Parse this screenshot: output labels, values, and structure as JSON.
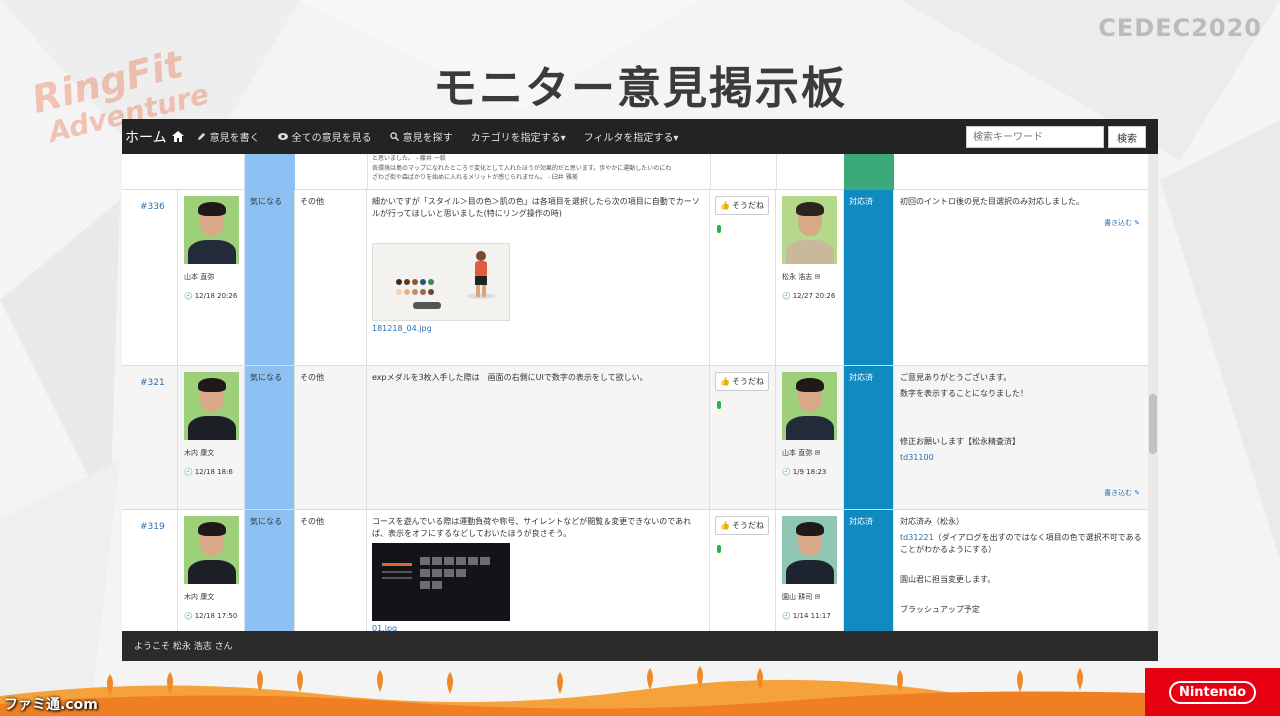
{
  "slide": {
    "title": "モニター意見掲示板",
    "cedec": "CEDEC2020",
    "ringfit_line1": "RingFit",
    "ringfit_line2": "Adventure",
    "famitsu": "ファミ通.com",
    "nintendo": "Nintendo"
  },
  "navbar": {
    "home": "ホーム",
    "items": [
      "意見を書く",
      "全ての意見を見る",
      "意見を探す",
      "カテゴリを指定する▾",
      "フィルタを指定する▾"
    ],
    "search_placeholder": "検索キーワード",
    "search_button": "検索"
  },
  "partial_row": {
    "line1": "と思いました。 - 藤井 一毅",
    "line2": "各環境は島のマップになれたところで変化として入れたほうが効果的だと思います。歩やかに運動したいのにわ",
    "line3": "ざわざ街や森ばかりを始めに入れるメリットが感じられません。 - 臼井 雅美"
  },
  "rows": [
    {
      "id": "#336",
      "user": "山本 直弥",
      "date": "12/18 20:26",
      "type": "気になる",
      "category": "その他",
      "body": "細かいですが「スタイル＞目の色＞肌の色」は各項目を選択したら次の項目に自動でカーソルが行ってほしいと思いました(特にリング操作の時)",
      "attachment": "181218_04.jpg",
      "like": "そうだね",
      "responder": "松永 浩志 ✉",
      "resp_date": "12/27 20:26",
      "status": "対応済",
      "reply": [
        "初回のイントロ後の見た目選択のみ対応しました。"
      ],
      "write": "書き込む"
    },
    {
      "id": "#321",
      "user": "木内 康文",
      "date": "12/18 18:6",
      "type": "気になる",
      "category": "その他",
      "body": "expメダルを3枚入手した際は　画面の右側にUIで数字の表示をして欲しい。",
      "like": "そうだね",
      "responder": "山本 直弥 ✉",
      "resp_date": "1/9 18:23",
      "status": "対応済",
      "reply": [
        "ご意見ありがとうございます。",
        "数字を表示することになりました！",
        "修正お願いします【松永精査済】"
      ],
      "reply_link": "td31100",
      "write": "書き込む"
    },
    {
      "id": "#319",
      "user": "木内 康文",
      "date": "12/18 17:50",
      "type": "気になる",
      "category": "その他",
      "body": "コースを遊んでいる際は運動負荷や称号、サイレントなどが閲覧＆変更できないのであれば、表示をオフにするなどしておいたほうが良さそう。",
      "attachment": "01.jpg",
      "like": "そうだね",
      "responder": "園山 耕司 ✉",
      "resp_date": "1/14 11:17",
      "status": "対応済",
      "reply_head": "対応済み（松永）",
      "reply_link": "td31221",
      "reply_rest": "（ダイアログを出すのではなく項目の色で選択不可であることがわかるようにする）",
      "reply_more": [
        "園山君に担当変更します。",
        "ブラッシュアップ予定"
      ]
    }
  ],
  "footer": {
    "welcome": "ようこそ 松永 浩志 さん"
  }
}
